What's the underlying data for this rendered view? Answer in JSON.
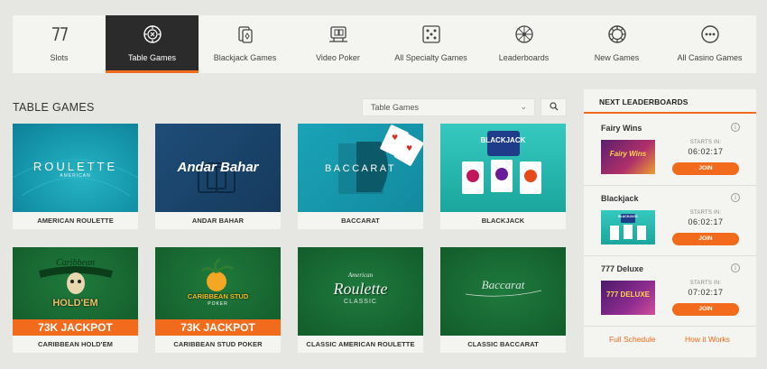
{
  "nav": {
    "items": [
      {
        "label": "Slots",
        "icon": "slots-seven-icon"
      },
      {
        "label": "Table Games",
        "icon": "roulette-chip-icon",
        "active": true
      },
      {
        "label": "Blackjack Games",
        "icon": "cards-icon"
      },
      {
        "label": "Video Poker",
        "icon": "video-poker-icon"
      },
      {
        "label": "All Specialty Games",
        "icon": "dice-icon"
      },
      {
        "label": "Leaderboards",
        "icon": "wheel-icon"
      },
      {
        "label": "New Games",
        "icon": "chip-icon"
      },
      {
        "label": "All Casino Games",
        "icon": "more-dots-icon"
      }
    ]
  },
  "section": {
    "title": "TABLE GAMES",
    "filter_value": "Table Games"
  },
  "games": [
    {
      "name": "AMERICAN ROULETTE",
      "art_title": "ROULETTE",
      "art_sub": "AMERICAN"
    },
    {
      "name": "ANDAR BAHAR",
      "art_title": "Andar Bahar"
    },
    {
      "name": "BACCARAT",
      "art_title": "BACCARAT"
    },
    {
      "name": "BLACKJACK",
      "art_title": "BLACKJACK"
    },
    {
      "name": "CARIBBEAN HOLD'EM",
      "art_title": "Caribbean",
      "art_sub": "HOLD'EM",
      "jackpot": "73K JACKPOT"
    },
    {
      "name": "CARIBBEAN STUD POKER",
      "art_title": "CARIBBEAN STUD",
      "art_sub": "POKER",
      "jackpot": "73K JACKPOT"
    },
    {
      "name": "CLASSIC AMERICAN ROULETTE",
      "art_title": "Roulette",
      "art_pre": "American",
      "art_sub": "CLASSIC"
    },
    {
      "name": "CLASSIC BACCARAT",
      "art_title": "Baccarat"
    }
  ],
  "leaderboards": {
    "heading": "NEXT LEADERBOARDS",
    "items": [
      {
        "title": "Fairy Wins",
        "starts_label": "STARTS IN:",
        "time": "06:02:17",
        "join_label": "JOIN",
        "art": "Fairy Wins"
      },
      {
        "title": "Blackjack",
        "starts_label": "STARTS IN:",
        "time": "06:02:17",
        "join_label": "JOIN",
        "art": "BLACKJACK"
      },
      {
        "title": "777 Deluxe",
        "starts_label": "STARTS IN:",
        "time": "07:02:17",
        "join_label": "JOIN",
        "art": "777 DELUXE"
      }
    ],
    "full_schedule": "Full Schedule",
    "how_it_works": "How it Works"
  },
  "colors": {
    "accent": "#f26a1b",
    "nav_active": "#2b2b2b",
    "background": "#e6e6e3"
  }
}
